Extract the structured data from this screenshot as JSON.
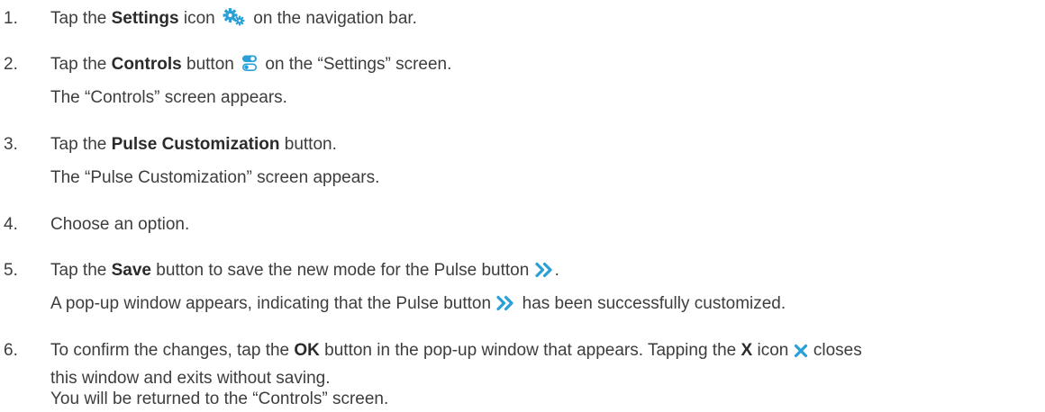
{
  "steps": [
    {
      "num": "1.",
      "lines": [
        {
          "a": "Tap the ",
          "b": "Settings",
          "c": " icon ",
          "icon": "settings-gears-icon",
          "d": " on the navigation bar."
        }
      ]
    },
    {
      "num": "2.",
      "lines": [
        {
          "a": "Tap the ",
          "b": "Controls",
          "c": " button ",
          "icon": "controls-toggle-icon",
          "d": " on the “Settings” screen."
        },
        {
          "text": "The “Controls” screen appears."
        }
      ]
    },
    {
      "num": "3.",
      "lines": [
        {
          "a": "Tap the ",
          "b": "Pulse Customization",
          "c": " button."
        },
        {
          "text": "The “Pulse Customization” screen appears."
        }
      ]
    },
    {
      "num": "4.",
      "lines": [
        {
          "text": "Choose an option."
        }
      ]
    },
    {
      "num": "5.",
      "lines": [
        {
          "a": "Tap the ",
          "b": "Save",
          "c": " button to save the new mode for the Pulse button ",
          "icon": "pulse-double-chevron-icon",
          "d": "."
        },
        {
          "a": "A pop-up window appears, indicating that the Pulse button ",
          "icon": "pulse-double-chevron-icon",
          "d": " has been successfully customized."
        }
      ]
    },
    {
      "num": "6.",
      "lines": [
        {
          "a": "To confirm the changes, tap the ",
          "b": "OK",
          "c": " button in the pop-up window that appears. Tapping the ",
          "b2": "X",
          "c2": " icon ",
          "icon": "close-x-icon",
          "d": " closes"
        },
        {
          "text": "this window and exits without saving."
        },
        {
          "text": "You will be returned to the “Controls” screen."
        }
      ]
    }
  ],
  "colors": {
    "text": "#3d3d3d",
    "icon_blue": "#2a9fd8"
  }
}
